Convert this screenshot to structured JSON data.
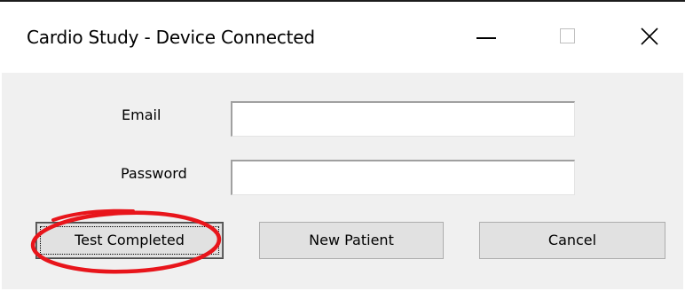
{
  "window": {
    "title": "Cardio Study - Device Connected",
    "controls": {
      "minimize": "minimize-icon",
      "maximize": "maximize-icon",
      "close": "close-icon"
    }
  },
  "form": {
    "email_label": "Email",
    "email_value": "",
    "password_label": "Password",
    "password_value": ""
  },
  "buttons": {
    "test_completed": "Test Completed",
    "new_patient": "New Patient",
    "cancel": "Cancel"
  },
  "annotation": {
    "color": "#e8151b",
    "shape": "ellipse",
    "target": "test_completed"
  }
}
